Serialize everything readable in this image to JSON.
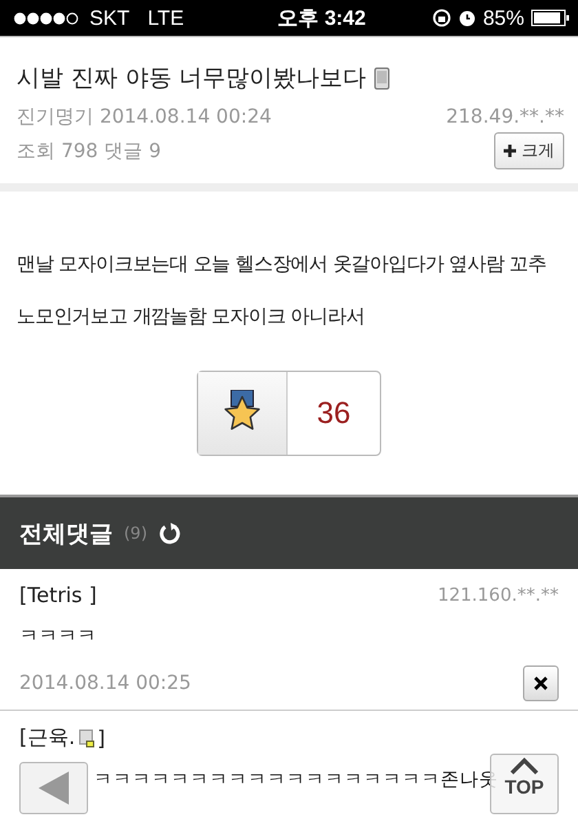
{
  "status_bar": {
    "carrier": "SKT",
    "network": "LTE",
    "time": "오후 3:42",
    "battery": "85%"
  },
  "post": {
    "title": "시발 진짜 야동 너무많이봤나보다",
    "author": "진기명기",
    "date": "2014.08.14 00:24",
    "ip": "218.49.**.**",
    "stats": "조회 798 댓글 9",
    "zoom_button": "크게",
    "body": "맨날 모자이크보는대 오늘 헬스장에서 옷갈아입다가 옆사람 꼬추 노모인거보고 개깜놀함 모자이크 아니라서",
    "votes": "36"
  },
  "comments_header": {
    "title": "전체댓글",
    "count": "(9)"
  },
  "comments": [
    {
      "author": "[Tetris ]",
      "ip": "121.160.**.**",
      "text": "ㅋㅋㅋㅋ",
      "date": "2014.08.14 00:25",
      "deletable": true
    },
    {
      "author": "[근육.",
      "author_end": "]",
      "text": "ㅋㅋㅋㅋㅋㅋㅋㅋㅋㅋㅋㅋㅋㅋㅋㅋㅋㅋ존나웃",
      "deletable": false
    }
  ],
  "overlay": {
    "top_button": "TOP"
  }
}
